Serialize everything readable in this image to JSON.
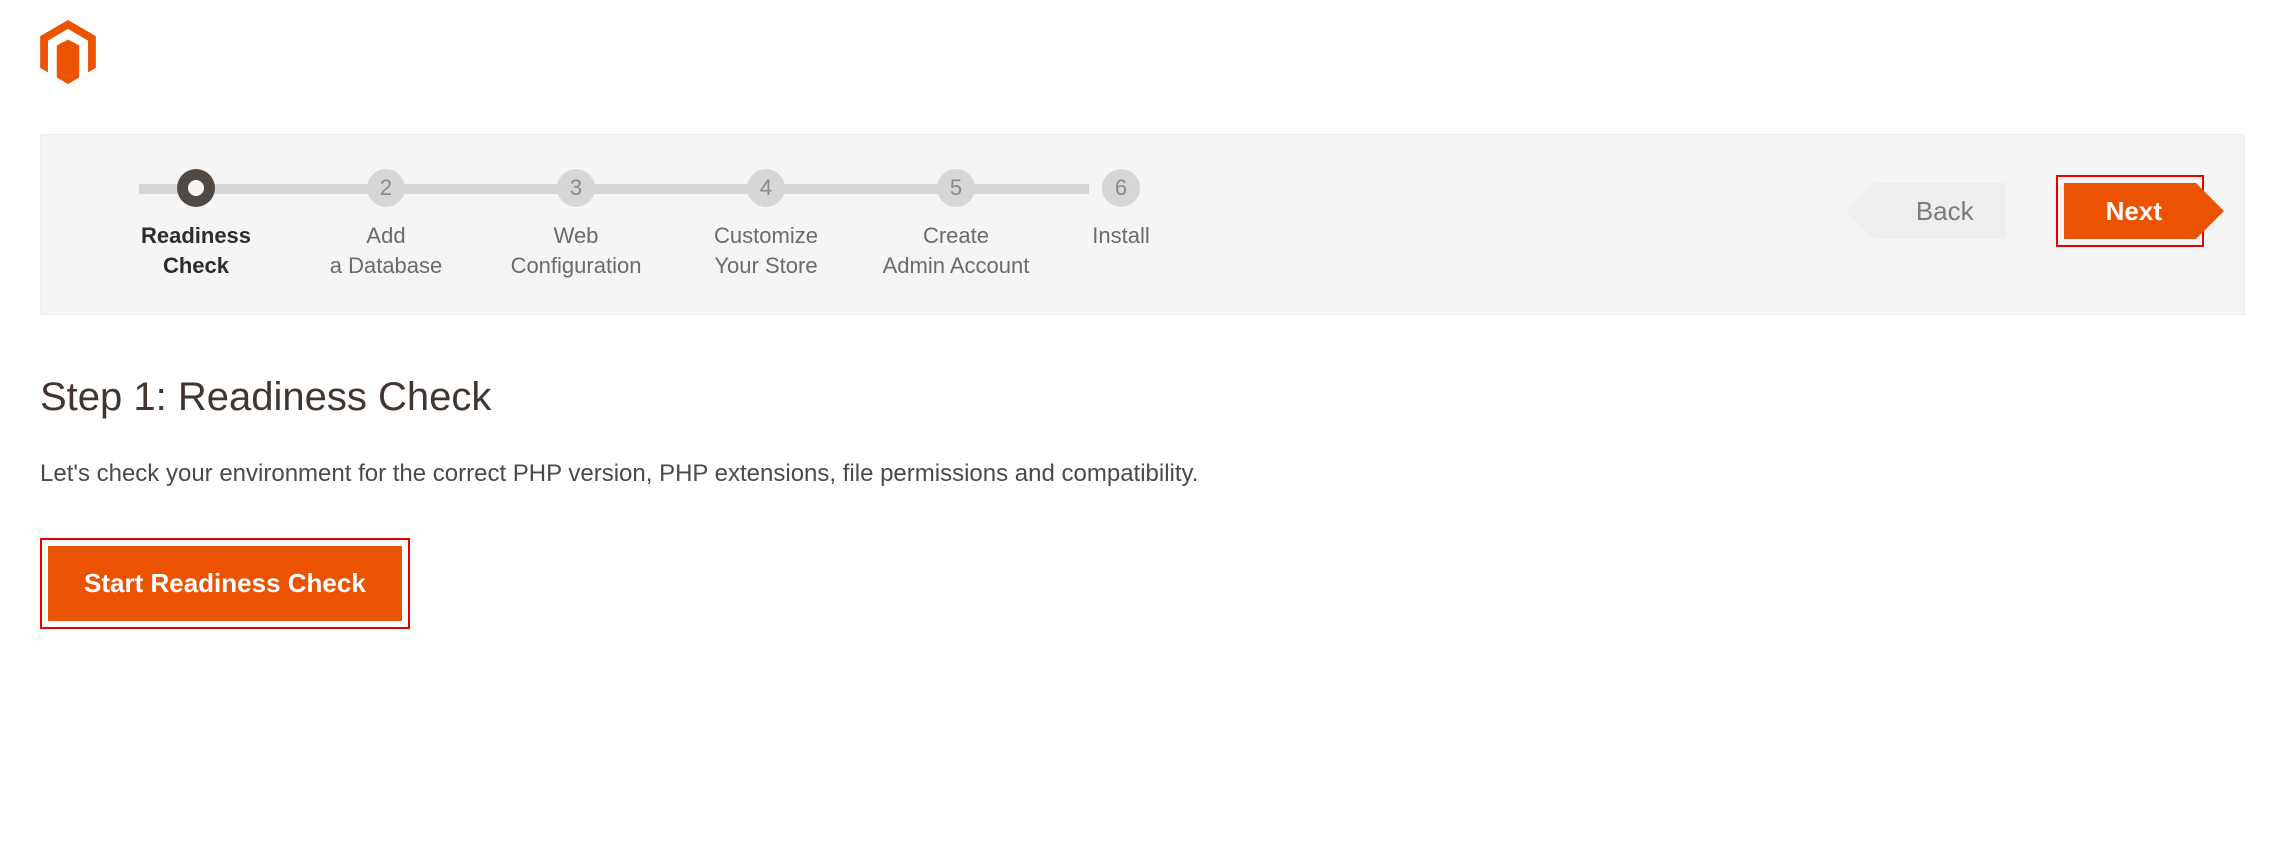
{
  "wizard": {
    "steps": [
      {
        "num": "",
        "label": "Readiness\nCheck",
        "active": true
      },
      {
        "num": "2",
        "label": "Add\na Database",
        "active": false
      },
      {
        "num": "3",
        "label": "Web\nConfiguration",
        "active": false
      },
      {
        "num": "4",
        "label": "Customize\nYour Store",
        "active": false
      },
      {
        "num": "5",
        "label": "Create\nAdmin Account",
        "active": false
      },
      {
        "num": "6",
        "label": "Install",
        "active": false
      }
    ],
    "back_label": "Back",
    "next_label": "Next"
  },
  "page": {
    "title": "Step 1: Readiness Check",
    "description": "Let's check your environment for the correct PHP version, PHP extensions, file permissions and compatibility.",
    "start_label": "Start Readiness Check"
  }
}
